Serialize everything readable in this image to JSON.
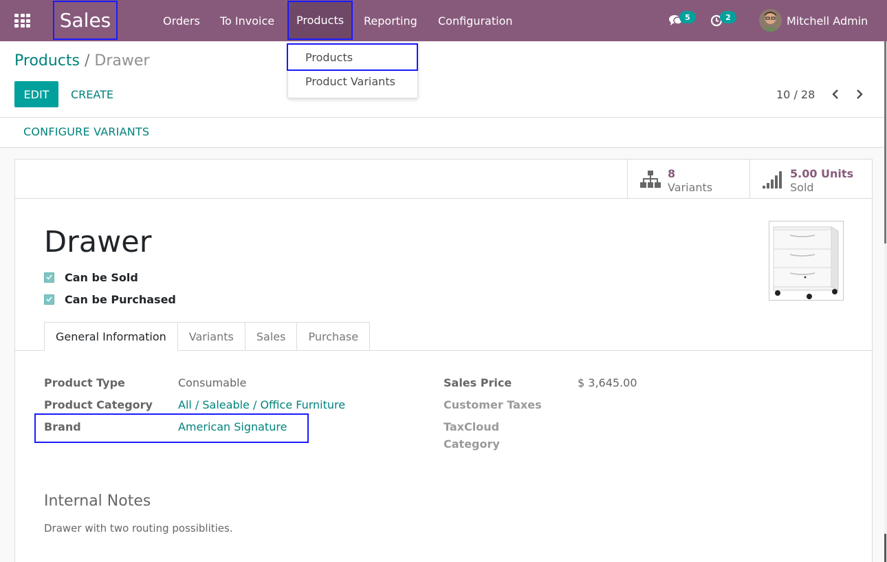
{
  "navbar": {
    "app_name": "Sales",
    "menu": [
      "Orders",
      "To Invoice",
      "Products",
      "Reporting",
      "Configuration"
    ],
    "messages_count": "5",
    "activities_count": "2",
    "user_name": "Mitchell Admin",
    "color": "#875a7b"
  },
  "dropdown": {
    "items": [
      "Products",
      "Product Variants"
    ]
  },
  "breadcrumb": {
    "parent": "Products",
    "separator": "/",
    "current": "Drawer"
  },
  "actions": {
    "edit": "EDIT",
    "create": "CREATE"
  },
  "pager": {
    "value": "10 / 28"
  },
  "statusbar": {
    "configure_variants": "CONFIGURE VARIANTS"
  },
  "stat_buttons": {
    "variants_value": "8",
    "variants_label": "Variants",
    "sold_value": "5.00 Units",
    "sold_label": "Sold"
  },
  "product": {
    "name": "Drawer",
    "can_be_sold": "Can be Sold",
    "can_be_purchased": "Can be Purchased"
  },
  "tabs": [
    "General Information",
    "Variants",
    "Sales",
    "Purchase"
  ],
  "fields": {
    "product_type_label": "Product Type",
    "product_type_value": "Consumable",
    "product_category_label": "Product Category",
    "product_category_value": "All / Saleable / Office Furniture",
    "brand_label": "Brand",
    "brand_value": "American Signature",
    "sales_price_label": "Sales Price",
    "sales_price_value": "$ 3,645.00",
    "customer_taxes_label": "Customer Taxes",
    "taxcloud_label_1": "TaxCloud",
    "taxcloud_label_2": "Category"
  },
  "notes": {
    "title": "Internal Notes",
    "text": "Drawer with two routing possiblities."
  }
}
